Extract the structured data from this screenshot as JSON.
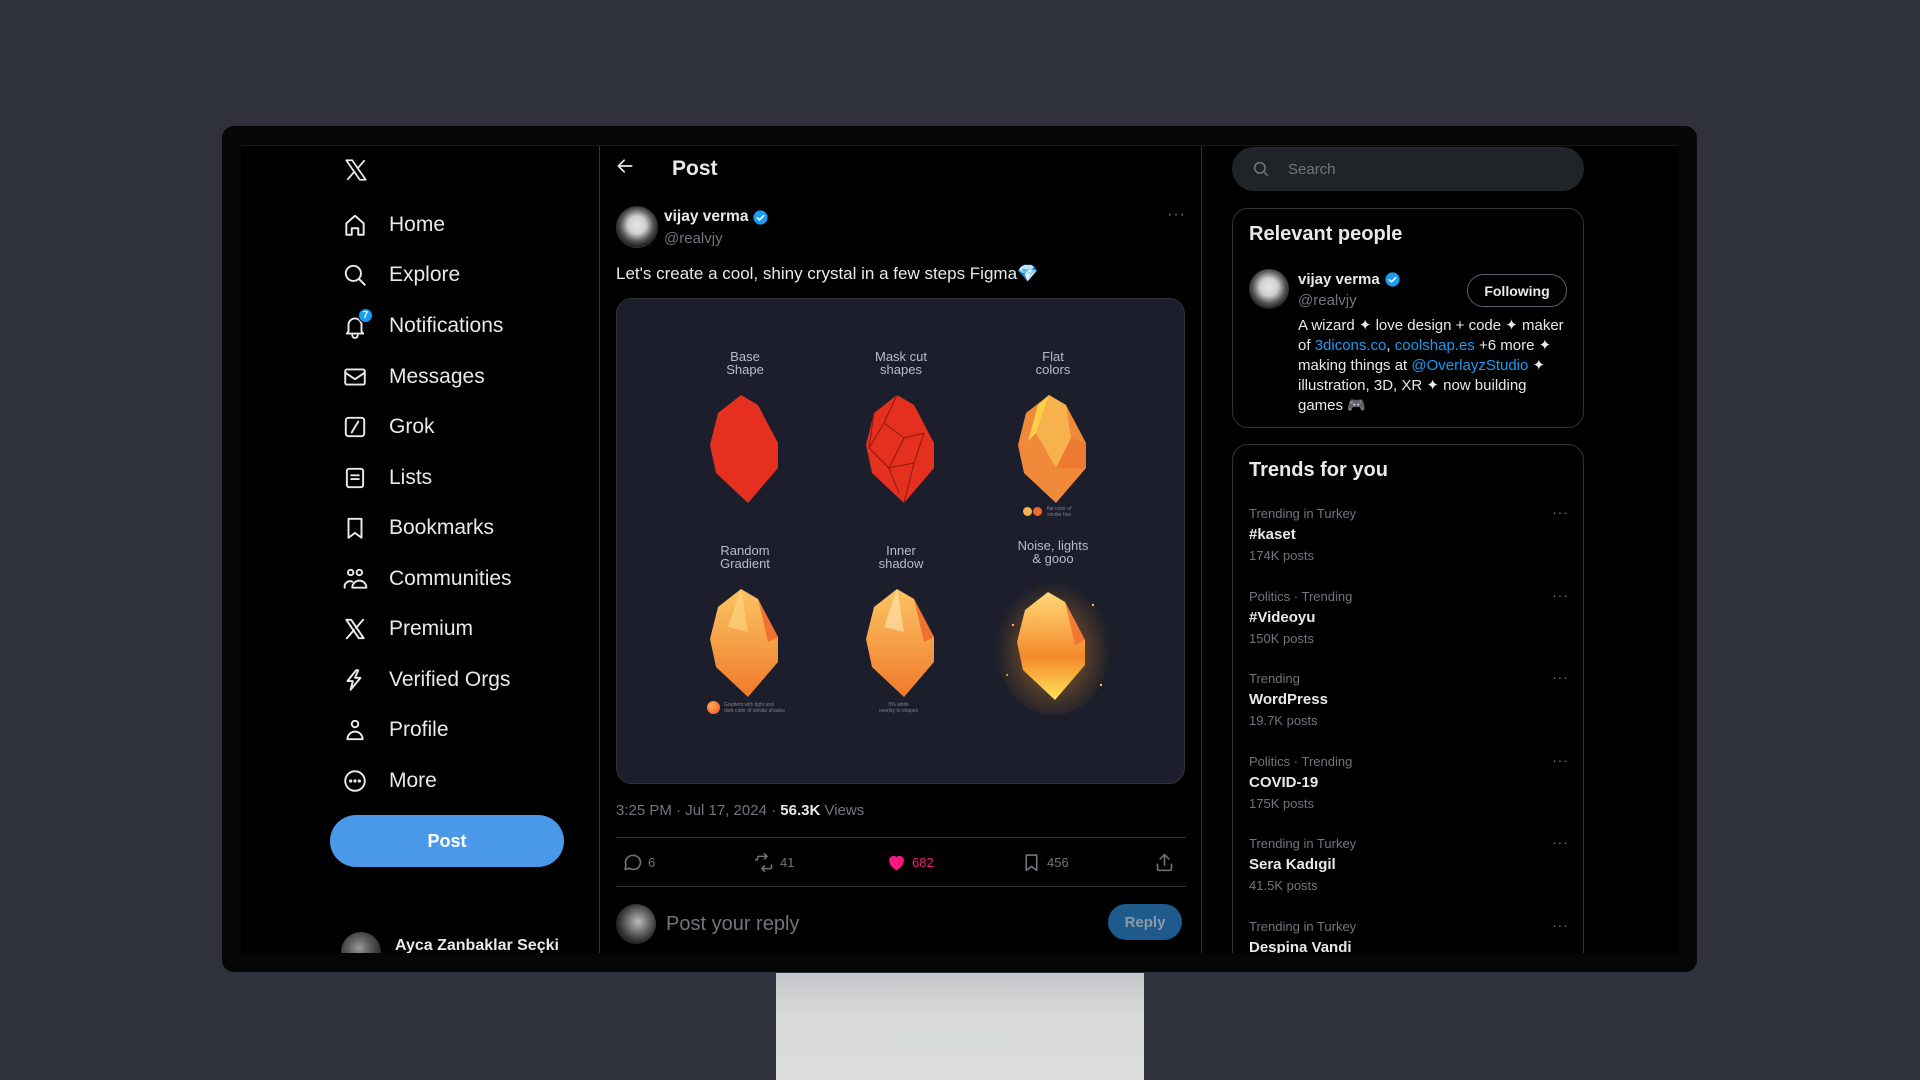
{
  "app": {
    "name": "X"
  },
  "sidebar": {
    "items": [
      {
        "label": "Home",
        "icon": "home-icon"
      },
      {
        "label": "Explore",
        "icon": "search-icon"
      },
      {
        "label": "Notifications",
        "icon": "bell-icon",
        "badge": "7"
      },
      {
        "label": "Messages",
        "icon": "mail-icon"
      },
      {
        "label": "Grok",
        "icon": "grok-icon"
      },
      {
        "label": "Lists",
        "icon": "list-icon"
      },
      {
        "label": "Bookmarks",
        "icon": "bookmark-icon"
      },
      {
        "label": "Communities",
        "icon": "communities-icon"
      },
      {
        "label": "Premium",
        "icon": "x-logo-icon"
      },
      {
        "label": "Verified Orgs",
        "icon": "lightning-icon"
      },
      {
        "label": "Profile",
        "icon": "person-icon"
      },
      {
        "label": "More",
        "icon": "more-circle-icon"
      }
    ],
    "post_button": "Post",
    "account": {
      "name": "Ayca Zanbaklar Seçki",
      "more": "···"
    }
  },
  "main": {
    "title": "Post",
    "post": {
      "author_name": "vijay verma",
      "author_handle": "@realvjy",
      "more": "···",
      "text": "Let's create a cool, shiny crystal in a few steps Figma💎",
      "media": {
        "steps": [
          {
            "label_1": "Base",
            "label_2": "Shape"
          },
          {
            "label_1": "Mask cut",
            "label_2": "shapes"
          },
          {
            "label_1": "Flat",
            "label_2": "colors",
            "caption_1": "flat color of",
            "caption_2": "similar hue"
          },
          {
            "label_1": "Random",
            "label_2": "Gradient",
            "caption_1": "Gradient with light and",
            "caption_2": "dark color of similar shades"
          },
          {
            "label_1": "Inner",
            "label_2": "shadow",
            "caption_1": "5% white",
            "caption_2": "overlay to shapes"
          },
          {
            "label_1": "Noise, lights",
            "label_2": "& gooo"
          }
        ]
      },
      "timestamp": "3:25 PM · Jul 17, 2024 · ",
      "views_count": "56.3K",
      "views_label": " Views",
      "stats": {
        "replies": "6",
        "reposts": "41",
        "likes": "682",
        "bookmarks": "456"
      },
      "liked": true
    },
    "reply": {
      "placeholder": "Post your reply",
      "button": "Reply"
    }
  },
  "right": {
    "search_placeholder": "Search",
    "relevant_people": {
      "title": "Relevant people",
      "person": {
        "name": "vijay verma",
        "handle": "@realvjy",
        "follow_button": "Following",
        "bio_1": "A wizard ✦ love design + code ✦ maker of ",
        "bio_link_1": "3dicons.co",
        "bio_sep": ", ",
        "bio_link_2": "coolshap.es",
        "bio_2": " +6 more ✦ making things at ",
        "bio_link_3": "@OverlayzStudio",
        "bio_3": " ✦ illustration, 3D, XR ✦ now building games 🎮"
      }
    },
    "trends": {
      "title": "Trends for you",
      "items": [
        {
          "meta": "Trending in Turkey",
          "name": "#kaset",
          "count": "174K posts"
        },
        {
          "meta": "Politics · Trending",
          "name": "#Videoyu",
          "count": "150K posts"
        },
        {
          "meta": "Trending",
          "name": "WordPress",
          "count": "19.7K posts"
        },
        {
          "meta": "Politics · Trending",
          "name": "COVID-19",
          "count": "175K posts"
        },
        {
          "meta": "Trending in Turkey",
          "name": "Sera Kadıgil",
          "count": "41.5K posts"
        },
        {
          "meta": "Trending in Turkey",
          "name": "Despina Vandi",
          "count": ""
        }
      ]
    }
  },
  "colors": {
    "accent": "#1d9bf0",
    "post_button": "#4a99e9",
    "like": "#f91880",
    "background": "#2f313c"
  }
}
